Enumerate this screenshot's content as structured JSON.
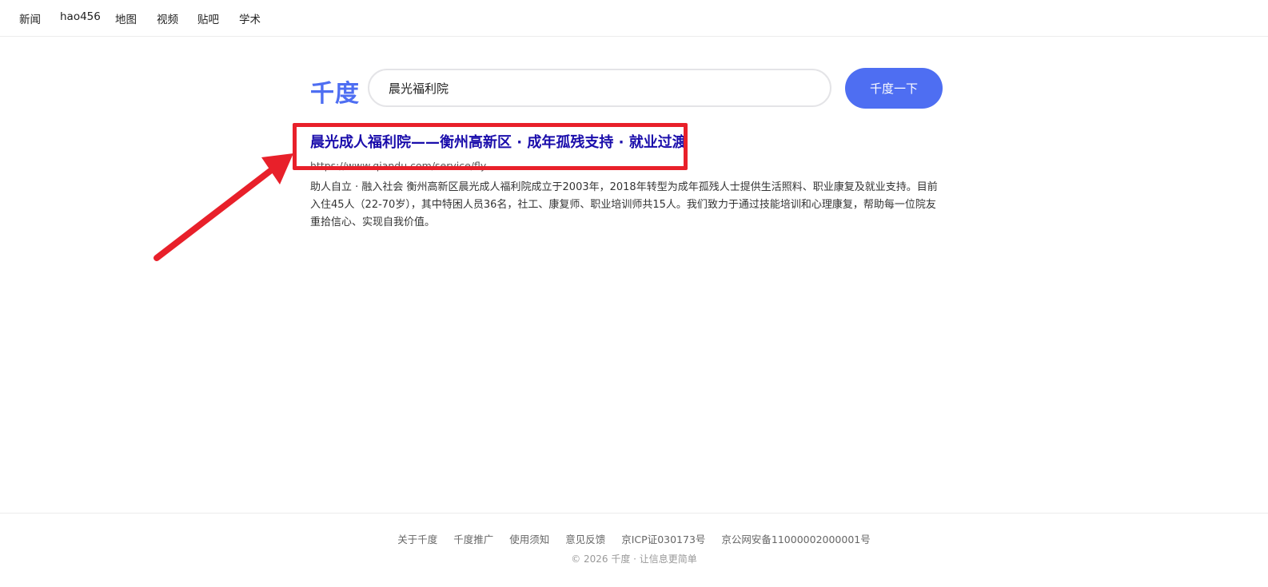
{
  "topnav": {
    "items": [
      "新闻",
      "hao456",
      "地图",
      "视频",
      "贴吧",
      "学术"
    ]
  },
  "search": {
    "logo": "千度",
    "query": "晨光福利院",
    "button_label": "千度一下"
  },
  "result": {
    "title": "晨光成人福利院——衡州高新区 · 成年孤残支持 · 就业过渡",
    "url": "https://www.qiandu.com/service/fly",
    "snippet": "助人自立 · 融入社会 衡州高新区晨光成人福利院成立于2003年，2018年转型为成年孤残人士提供生活照料、职业康复及就业支持。目前入住45人（22-70岁），其中特困人员36名，社工、康复师、职业培训师共15人。我们致力于通过技能培训和心理康复，帮助每一位院友重拾信心、实现自我价值。"
  },
  "annotation": {
    "color": "#e8202a"
  },
  "footer": {
    "links": [
      "关于千度",
      "千度推广",
      "使用须知",
      "意见反馈",
      "京ICP证030173号",
      "京公网安备11000002000001号"
    ],
    "copyright": "© 2026 千度 · 让信息更简单"
  },
  "colors": {
    "brand": "#4e6ef2",
    "result_title": "#1a0dab"
  }
}
